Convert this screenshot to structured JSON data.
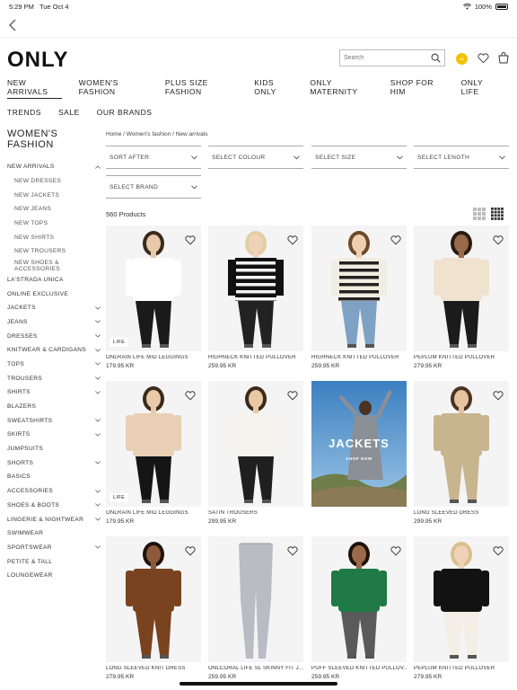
{
  "status": {
    "time": "5:29 PM",
    "date": "Tue Oct 4",
    "battery": "100%"
  },
  "brand": {
    "logo": "ONLY"
  },
  "search": {
    "placeholder": "Search"
  },
  "nav": {
    "row1": [
      "NEW ARRIVALS",
      "WOMEN'S FASHION",
      "PLUS SIZE FASHION",
      "KIDS ONLY",
      "ONLY MATERNITY",
      "SHOP FOR HIM",
      "ONLY LIFE"
    ],
    "row2": [
      "TRENDS",
      "SALE",
      "OUR BRANDS"
    ]
  },
  "sidebar": {
    "title": "WOMEN'S FASHION",
    "items": [
      {
        "label": "NEW ARRIVALS",
        "chev": "up"
      },
      {
        "label": "NEW DRESSES",
        "sub": true
      },
      {
        "label": "NEW JACKETS",
        "sub": true
      },
      {
        "label": "NEW JEANS",
        "sub": true
      },
      {
        "label": "NEW TOPS",
        "sub": true
      },
      {
        "label": "NEW SHIRTS",
        "sub": true
      },
      {
        "label": "NEW TROUSERS",
        "sub": true
      },
      {
        "label": "NEW SHOES & ACCESSORIES",
        "sub": true
      },
      {
        "label": "LA'STRADA UNICA"
      },
      {
        "label": "ONLINE EXCLUSIVE"
      },
      {
        "label": "JACKETS",
        "chev": "down"
      },
      {
        "label": "JEANS",
        "chev": "down"
      },
      {
        "label": "DRESSES",
        "chev": "down"
      },
      {
        "label": "KNITWEAR & CARDIGANS",
        "chev": "down"
      },
      {
        "label": "TOPS",
        "chev": "down"
      },
      {
        "label": "TROUSERS",
        "chev": "down"
      },
      {
        "label": "SHIRTS",
        "chev": "down"
      },
      {
        "label": "BLAZERS"
      },
      {
        "label": "SWEATSHIRTS",
        "chev": "down"
      },
      {
        "label": "SKIRTS",
        "chev": "down"
      },
      {
        "label": "JUMPSUITS"
      },
      {
        "label": "SHORTS",
        "chev": "down"
      },
      {
        "label": "BASICS"
      },
      {
        "label": "ACCESSORIES",
        "chev": "down"
      },
      {
        "label": "SHOES & BOOTS",
        "chev": "down"
      },
      {
        "label": "LINGERIE & NIGHTWEAR",
        "chev": "down"
      },
      {
        "label": "SWIMWEAR"
      },
      {
        "label": "SPORTSWEAR",
        "chev": "down"
      },
      {
        "label": "PETITE & TALL"
      },
      {
        "label": "LOUNGEWEAR"
      }
    ]
  },
  "breadcrumb": "Home  /  Women's fashion  /  New arrivals",
  "filters": [
    "SORT AFTER:",
    "SELECT COLOUR",
    "SELECT SIZE",
    "SELECT LENGTH",
    "SELECT BRAND"
  ],
  "product_count": "560 Products",
  "products": [
    {
      "name": "ONLRAIN LIFE MID LEGGINGS",
      "price": "179.95 KR",
      "badge": "LIFE",
      "top": "#ffffff",
      "bottom": "#1a1a1a",
      "skin": "#e8c9a8",
      "hair": "#3a2a1c"
    },
    {
      "name": "HIGHNECK KNITTED PULLOVER",
      "price": "259.95 KR",
      "top": "stripes-dark",
      "bottom": "#222222",
      "skin": "#f0d2b8",
      "hair": "#e2cfa2"
    },
    {
      "name": "HIGHNECK KNITTED PULLOVER",
      "price": "259.95 KR",
      "top": "stripes-light",
      "bottom": "#7fa1c4",
      "skin": "#efcfb0",
      "hair": "#6b4a2e"
    },
    {
      "name": "PEPLUM KNITTED PULLOVER",
      "price": "279.95 KR",
      "top": "#efe2cf",
      "bottom": "#1b1b1b",
      "skin": "#9a6a4a",
      "hair": "#2a1b10"
    },
    {
      "name": "ONLRAIN LIFE MID LEGGINGS",
      "price": "179.95 KR",
      "badge": "LIFE",
      "top": "#e9cfb4",
      "bottom": "#151515",
      "skin": "#e8c9a8",
      "hair": "#3a2a1c"
    },
    {
      "name": "SATIN TROUSERS",
      "price": "299.95 KR",
      "top": "#f6f3ee",
      "bottom": "#1f1f1f",
      "skin": "#e9c8a6",
      "hair": "#3b2a1a"
    },
    {
      "name": "",
      "price": "",
      "promo": true,
      "promo_title": "JACKETS",
      "promo_sub": "SHOP NOW"
    },
    {
      "name": "LONG SLEEVED DRESS",
      "price": "299.95 KR",
      "top": "#c7b58e",
      "bottom": "#c7b58e",
      "skin": "#e7c3a2",
      "hair": "#4a3320"
    },
    {
      "name": "LONG SLEEVED KNIT DRESS",
      "price": "279.95 KR",
      "top": "#7a4320",
      "bottom": "#7a4320",
      "skin": "#8c5a3a",
      "hair": "#1e130b"
    },
    {
      "name": "ONLCORAL LIFE SL SKINNY FIT J...",
      "price": "259.95 KR",
      "top": "none",
      "bottom": "#b9bcc2",
      "skin": "#e8c9a8",
      "hair": "#000"
    },
    {
      "name": "PUFF SLEEVED KNITTED PULLOV...",
      "price": "259.95 KR",
      "top": "#1f7a45",
      "bottom": "#5a5a5a",
      "skin": "#9c6a4a",
      "hair": "#1e130b"
    },
    {
      "name": "PEPLUM KNITTED PULLOVER",
      "price": "279.95 KR",
      "top": "#121212",
      "bottom": "#f3efe6",
      "skin": "#efd2b8",
      "hair": "#d9c08d"
    }
  ]
}
